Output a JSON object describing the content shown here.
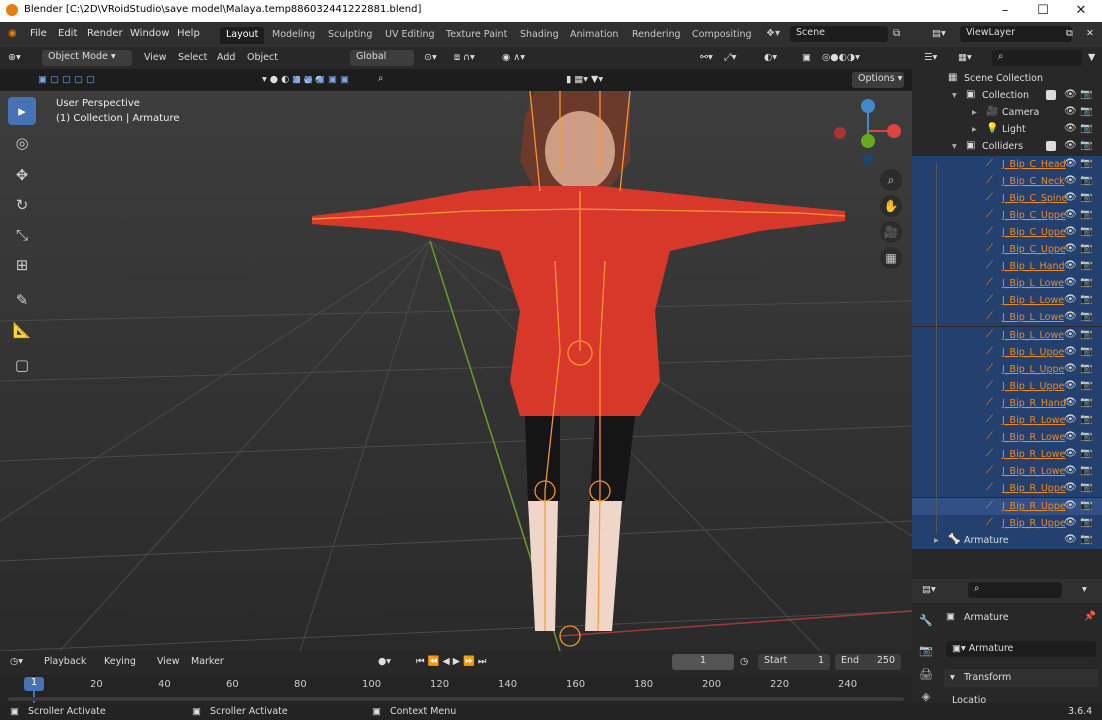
{
  "window": {
    "title": "Blender [C:\\2D\\VRoidStudio\\save model\\Malaya.temp886032441222881.blend]"
  },
  "menus": [
    "File",
    "Edit",
    "Render",
    "Window",
    "Help"
  ],
  "workspaces": [
    "Layout",
    "Modeling",
    "Sculpting",
    "UV Editing",
    "Texture Paint",
    "Shading",
    "Animation",
    "Rendering",
    "Compositing"
  ],
  "scene": {
    "name": "Scene"
  },
  "viewlayer": {
    "name": "ViewLayer"
  },
  "viewport_header": {
    "mode": "Object Mode",
    "menus": [
      "View",
      "Select",
      "Add",
      "Object"
    ],
    "orientation": "Global",
    "options": "Options"
  },
  "viewport": {
    "perspective_label": "User Perspective",
    "collection_label": "(1) Collection | Armature"
  },
  "outliner": {
    "rows": [
      {
        "label": "Scene Collection",
        "type": "scene"
      },
      {
        "label": "Collection",
        "type": "collection"
      },
      {
        "label": "Camera",
        "type": "object"
      },
      {
        "label": "Light",
        "type": "object"
      },
      {
        "label": "Colliders",
        "type": "collection"
      },
      {
        "label": "J_Bip_C_Head",
        "type": "bone"
      },
      {
        "label": "J_Bip_C_Neck",
        "type": "bone"
      },
      {
        "label": "J_Bip_C_Spine",
        "type": "bone"
      },
      {
        "label": "J_Bip_C_Uppe",
        "type": "bone"
      },
      {
        "label": "J_Bip_C_Uppe",
        "type": "bone"
      },
      {
        "label": "J_Bip_C_Uppe",
        "type": "bone"
      },
      {
        "label": "J_Bip_L_Hand",
        "type": "bone"
      },
      {
        "label": "J_Bip_L_Lowe",
        "type": "bone"
      },
      {
        "label": "J_Bip_L_Lowe",
        "type": "bone"
      },
      {
        "label": "J_Bip_L_Lowe",
        "type": "bone"
      },
      {
        "label": "J_Bip_L_Lowe",
        "type": "bone"
      },
      {
        "label": "J_Bip_L_Uppe",
        "type": "bone"
      },
      {
        "label": "J_Bip_L_Uppe",
        "type": "bone"
      },
      {
        "label": "J_Bip_L_Uppe",
        "type": "bone"
      },
      {
        "label": "J_Bip_R_Hand",
        "type": "bone"
      },
      {
        "label": "J_Bip_R_Lowe",
        "type": "bone"
      },
      {
        "label": "J_Bip_R_Lowe",
        "type": "bone"
      },
      {
        "label": "J_Bip_R_Lowe",
        "type": "bone"
      },
      {
        "label": "J_Bip_R_Lowe",
        "type": "bone"
      },
      {
        "label": "J_Bip_R_Uppe",
        "type": "bone"
      },
      {
        "label": "J_Bip_R_Uppe",
        "type": "bone"
      },
      {
        "label": "J_Bip_R_Uppe",
        "type": "bone"
      },
      {
        "label": "Armature",
        "type": "armature"
      }
    ]
  },
  "properties": {
    "object_name": "Armature",
    "data_name": "Armature",
    "panel": "Transform",
    "location_label": "Locatio"
  },
  "timeline": {
    "menus": [
      "Playback",
      "Keying",
      "View",
      "Marker"
    ],
    "current_frame": "1",
    "start_label": "Start",
    "start": "1",
    "end_label": "End",
    "end": "250",
    "ticks": [
      "20",
      "40",
      "60",
      "80",
      "100",
      "120",
      "140",
      "160",
      "180",
      "200",
      "220",
      "240"
    ],
    "cursor_frame": "1"
  },
  "status": {
    "left": "Scroller Activate",
    "middle": "Scroller Activate",
    "right": "Context Menu",
    "version": "3.6.4"
  },
  "colors": {
    "accent": "#4772b3",
    "selection": "#e87d0d"
  }
}
